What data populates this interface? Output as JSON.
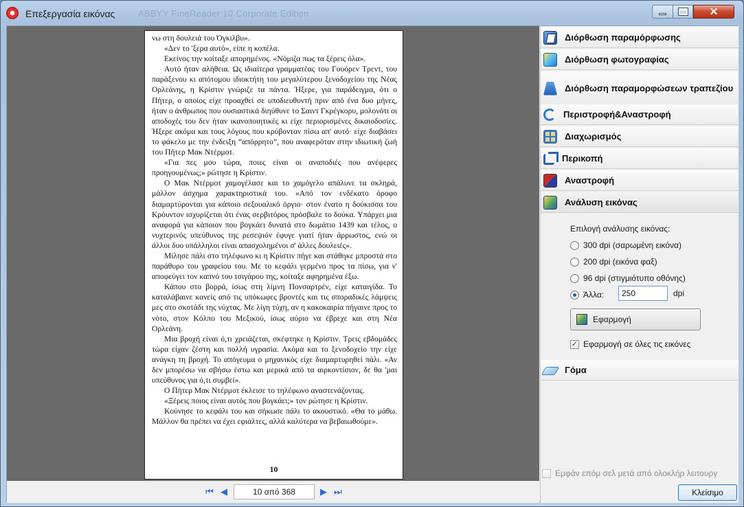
{
  "window": {
    "title": "Επεξεργασία εικόνας",
    "background_title": "ABBYY FineReader 10 Corporate Edition"
  },
  "document": {
    "paragraphs": [
      {
        "indent": false,
        "text": "νω στη δουλειά του Όγκιλβυ»."
      },
      {
        "indent": true,
        "text": "«Δεν το 'ξερα αυτό», είπε η κοπέλα."
      },
      {
        "indent": true,
        "text": "Εκείνος την κοίταξε απορημένος. «Νόμιζα πως τα ξέρεις όλα»."
      },
      {
        "indent": true,
        "text": "Αυτό ήταν αλήθεια. Ως ιδιαίτερα γραμματέας του Γουόρεν Τρεντ, του παράξενου κι απότομου ιδιοκτήτη του μεγαλύτερου ξενοδοχείου της Νέας Ορλεάνης, η Κρίστιν γνώριζε τα πάντα. Ήξερε, για παράδειγμα, ότι ο Πήτερ, ο οποίος είχε προαχθεί σε υποδιευθυντή πριν από ένα δυο μήνες, ήταν ο άνθρωπος που ουσιαστικά διηύθυνε το Σαιντ Γκρέγκορυ, μολονότι οι αποδοχές του δεν ήταν ικανοποιητικές κι είχε περιορισμένες δικαιοδοσίες. Ήξερε ακόμα και τους λόγους που κρύβονταν πίσω απ' αυτό· είχε διαβάσει το φάκελο με την ένδειξη “απόρρητο”, που αναφερόταν στην ιδιωτική ζωή του Πήτερ Μακ Ντέρμοτ."
      },
      {
        "indent": true,
        "text": "«Για πες μου τώρα, ποιες είναι οι αναποδιές που ανέφερες προηγουμένως;» ρώτησε η Κρίστιν."
      },
      {
        "indent": true,
        "text": "Ο Μακ Ντέρμοτ χαμογέλασε και το χαμόγελο απάλυνε τα σκληρά, μάλλον άσχημα χαρακτηριστικά του. «Από τον ενδέκατο όροφο διαμαρτύρονται για κάποιο σεξουαλικό όργιο· στον ένατο η δούκισσα του Κρόυντον ισχυρίζεται ότι ένας σερβιτόρος πρόσβαλε το δούκα. Υπάρχει μια αναφορά για κάποιον που βογκάει δυνατά στο δωμάτιο 1439 και τέλος, ο νυχτερινός υπεύθυνος της ρεσεψιόν έφυγε γιατί ήταν άρρωστος, ενώ οι άλλοι δυο υπάλληλοι είναι απασχολημένοι σ' άλλες δουλειές»."
      },
      {
        "indent": true,
        "text": "Μίλησε πάλι στο τηλέφωνο κι η Κρίστιν πήγε και στάθηκε μπροστά στο παράθυρο του γραφείου του. Με το κεφάλι γερμένο προς τα πίσω, για ν' αποφεύγει τον καπνό του τσιγάρου της, κοίταξε αφηρημένα έξω."
      },
      {
        "indent": true,
        "text": "Κάπου στο βορρά, ίσως στη λίμνη Πονσαρτρέν, είχε καταιγίδα. Το καταλάβαινε κανείς από τις υπόκωφες βροντές και τις σποραδικές λάμψεις μες στο σκοτάδι της νύχτας. Με λίγη τύχη, αν η κακοκαιρία πήγαινε προς το νότο, στον Κόλπο του Μεξικού, ίσως αύριο να έβρεχε και στη Νέα Ορλεάνη."
      },
      {
        "indent": true,
        "text": "Μια βροχή είναι ό,τι χρειάζεται, σκέφτηκε η Κρίστιν. Τρεις εβδομάδες τώρα είχαν ζέστη και πολλή υγρασία. Ακόμα και το ξενοδοχείο την είχε ανάγκη τη βροχή. Το απόγευμα ο μηχανικός είχε διαμαρτυρηθεί πάλι. «Αν δεν μπορέσω να σβήσω έστω και μερικά από τα αιρκοντίσιον, δε θα 'μαι υπεύθυνος για ό,τι συμβεί»."
      },
      {
        "indent": true,
        "text": "Ο Πήτερ Μακ Ντέρμοτ έκλεισε το τηλέφωνο αναστενάζοντας."
      },
      {
        "indent": true,
        "text": "«Ξέρεις ποιος είναι αυτός που βογκάει;» τον ρώτησε η Κρίστιν."
      },
      {
        "indent": true,
        "text": "Κούνησε το κεφάλι του και σήκωσε πάλι το ακουστικό. «Θα το μάθω. Μάλλον θα πρέπει να έχει εφιάλτες, αλλά καλύτερα να βεβαιωθούμε»."
      }
    ],
    "page_number": "10"
  },
  "navigation": {
    "page_indicator": "10 από 368",
    "first_icon": "first-page-icon",
    "prev_icon": "previous-page-icon",
    "next_icon": "next-page-icon",
    "last_icon": "last-page-icon"
  },
  "panel": {
    "sections": [
      {
        "key": "distortion",
        "label": "Διόρθωση παραμόρφωσης",
        "icon": "distortion-correction-icon"
      },
      {
        "key": "photo",
        "label": "Διόρθωση φωτογραφίας",
        "icon": "photo-correction-icon"
      },
      {
        "key": "trapezoid",
        "label": "Διόρθωση παραμορφώσεων τραπεζίου",
        "icon": "trapezoid-correction-icon"
      },
      {
        "key": "rotate",
        "label": "Περιστροφή&Αναστροφή",
        "icon": "rotate-flip-icon"
      },
      {
        "key": "split",
        "label": "Διαχωρισμός",
        "icon": "split-icon"
      },
      {
        "key": "crop",
        "label": "Περικοπή",
        "icon": "crop-icon"
      },
      {
        "key": "invert",
        "label": "Αναστροφή",
        "icon": "invert-icon"
      },
      {
        "key": "analysis",
        "label": "Ανάλυση εικόνας",
        "icon": "image-resolution-icon"
      },
      {
        "key": "eraser",
        "label": "Γόμα",
        "icon": "eraser-icon"
      }
    ],
    "analysis": {
      "prompt": "Επιλογή ανάλυσης εικόνας:",
      "options": [
        {
          "label": "300 dpi (σαρωμένη εικόνα)",
          "checked": false
        },
        {
          "label": "200 dpi (εικόνα φαξ)",
          "checked": false
        },
        {
          "label": "96 dpi (στιγμιότυπο οθόνης)",
          "checked": false
        },
        {
          "label": "Άλλα:",
          "checked": true
        }
      ],
      "custom_value": "250",
      "unit": "dpi",
      "apply_label": "Εφαρμογή",
      "apply_all_label": "Εφαρμογή σε όλες τις εικόνες",
      "apply_all_checked": true
    },
    "footer_checkbox_label": "Εμφάν επόμ σελ μετά από ολοκλήρ λειτουργ",
    "close_label": "Κλείσιμο"
  }
}
